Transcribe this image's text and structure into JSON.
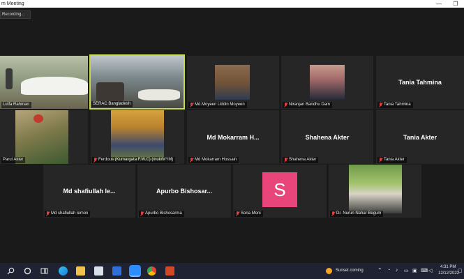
{
  "window": {
    "title": "m Meeting",
    "minimize": "—",
    "restore": "❐"
  },
  "recording": {
    "label": "Recording..."
  },
  "participants": [
    {
      "name": "Lutfa Rahman",
      "muted": false,
      "display": "video"
    },
    {
      "name": "SERAC Bangladesh",
      "muted": false,
      "display": "video",
      "active": true
    },
    {
      "name": "Md.Moyeen Uddin Moyeen",
      "muted": true,
      "display": "photo"
    },
    {
      "name": "Niranjan Bandhu Dam",
      "muted": true,
      "display": "photo"
    },
    {
      "name": "Tania Tahmina",
      "muted": true,
      "display": "name",
      "big_name": "Tania Tahmina"
    },
    {
      "name": "Parul Akter",
      "muted": false,
      "display": "photo"
    },
    {
      "name": "Ferdous (Kumargata F.W.C) (muk/MYM)",
      "muted": true,
      "display": "photo"
    },
    {
      "name": "Md Mokarram Hossain",
      "muted": true,
      "display": "name",
      "big_name": "Md Mokarram H..."
    },
    {
      "name": "Shahena Akter",
      "muted": true,
      "display": "name",
      "big_name": "Shahena Akter"
    },
    {
      "name": "Tania Akter",
      "muted": true,
      "display": "name",
      "big_name": "Tania Akter"
    },
    {
      "name": "Md shafiullah lemon",
      "muted": true,
      "display": "name",
      "big_name": "Md shafiullah le..."
    },
    {
      "name": "Apurbo Bishosarma",
      "muted": true,
      "display": "name",
      "big_name": "Apurbo Bishosar..."
    },
    {
      "name": "Sona Moni",
      "muted": true,
      "display": "avatar",
      "avatar_letter": "S",
      "avatar_color": "#e8457a"
    },
    {
      "name": "Dr. Nurun Nahar Begum",
      "muted": true,
      "display": "photo"
    }
  ],
  "taskbar": {
    "weather": "Sunset coming",
    "time": "4:31 PM",
    "date": "12/12/2022"
  }
}
